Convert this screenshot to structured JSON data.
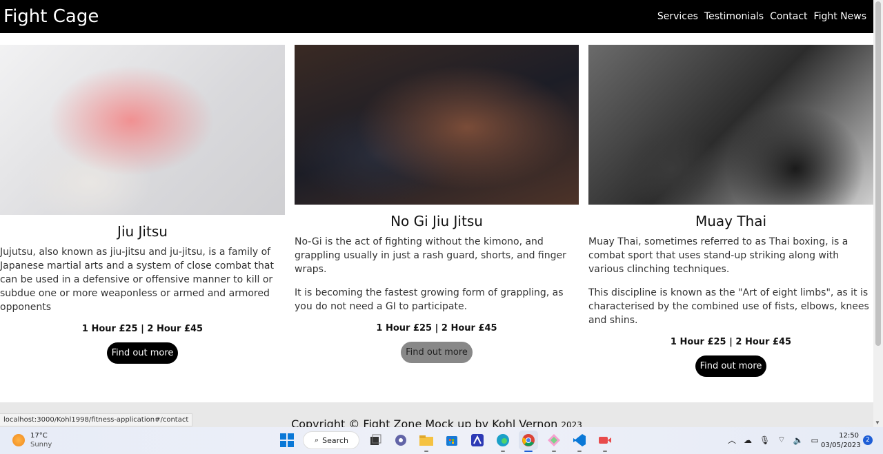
{
  "header": {
    "brand": "Fight Cage",
    "nav": [
      "Services",
      "Testimonials",
      "Contact",
      "Fight News"
    ]
  },
  "cards": [
    {
      "title": "Jiu Jitsu",
      "paragraphs": [
        "Jujutsu, also known as jiu-jitsu and ju-jitsu, is a family of Japanese martial arts and a system of close combat that can be used in a defensive or offensive manner to kill or subdue one or more weaponless or armed and armored opponents"
      ],
      "price": "1 Hour £25 | 2 Hour £45",
      "button": "Find out more"
    },
    {
      "title": "No Gi Jiu Jitsu",
      "paragraphs": [
        "No-Gi is the act of fighting without the kimono, and grappling usually in just a rash guard, shorts, and finger wraps.",
        "It is becoming the fastest growing form of grappling, as you do not need a GI to participate."
      ],
      "price": "1 Hour £25 | 2 Hour £45",
      "button": "Find out more"
    },
    {
      "title": "Muay Thai",
      "paragraphs": [
        "Muay Thai, sometimes referred to as Thai boxing, is a combat sport that uses stand-up striking along with various clinching techniques.",
        "This discipline is known as the \"Art of eight limbs\", as it is characterised by the combined use of fists, elbows, knees and shins."
      ],
      "price": "1 Hour £25 | 2 Hour £45",
      "button": "Find out more"
    }
  ],
  "footer": {
    "text": "Copyright © Fight Zone Mock up by Kohl Vernon",
    "year": "2023"
  },
  "status_url": "localhost:3000/Kohl1998/fitness-application#/contact",
  "taskbar": {
    "weather_temp": "17°C",
    "weather_desc": "Sunny",
    "search_label": "Search",
    "time": "12:50",
    "date": "03/05/2023",
    "notifications": "2"
  }
}
